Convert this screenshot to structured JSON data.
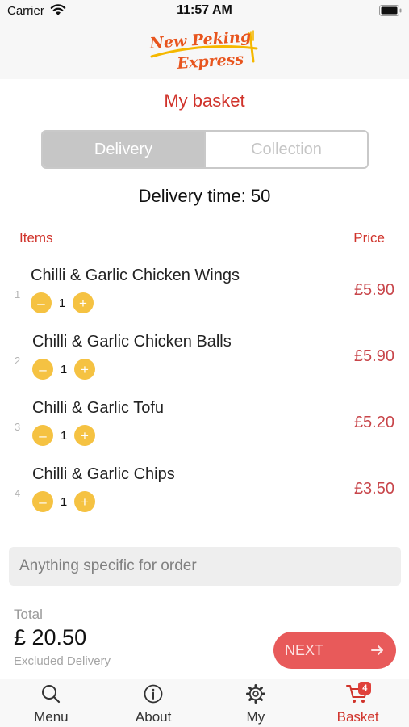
{
  "status_bar": {
    "carrier": "Carrier",
    "time": "11:57 AM"
  },
  "header": {
    "logo_line1": "New Peking",
    "logo_line2": "Express",
    "logo_color": "#e8551e",
    "logo_accent": "#f5b800"
  },
  "page": {
    "title": "My basket"
  },
  "order_type": {
    "options": [
      "Delivery",
      "Collection"
    ],
    "selected": "Delivery"
  },
  "delivery_time": "Delivery time: 50",
  "columns": {
    "items": "Items",
    "price": "Price"
  },
  "items": [
    {
      "index": "1",
      "name": "Chilli & Garlic Chicken Wings",
      "qty": "1",
      "price": "£5.90"
    },
    {
      "index": "2",
      "name": "Chilli & Garlic Chicken Balls",
      "qty": "1",
      "price": "£5.90"
    },
    {
      "index": "3",
      "name": "Chilli & Garlic Tofu",
      "qty": "1",
      "price": "£5.20"
    },
    {
      "index": "4",
      "name": "Chilli & Garlic Chips",
      "qty": "1",
      "price": "£3.50"
    }
  ],
  "qty_controls": {
    "minus": "–",
    "plus": "+"
  },
  "notes": {
    "placeholder": "Anything specific for order",
    "value": ""
  },
  "total": {
    "label": "Total",
    "value": "£ 20.50",
    "note": "Excluded Delivery"
  },
  "next_button": {
    "label": "NEXT",
    "icon": "arrow-right-icon"
  },
  "tabbar": {
    "tabs": [
      {
        "label": "Menu",
        "icon": "search-icon"
      },
      {
        "label": "About",
        "icon": "info-icon"
      },
      {
        "label": "My",
        "icon": "gear-icon"
      },
      {
        "label": "Basket",
        "icon": "cart-icon",
        "badge": "4"
      }
    ],
    "active": "Basket"
  },
  "colors": {
    "accent": "#d0332b",
    "price": "#c8454a",
    "qty_button": "#f5c242",
    "next_button": "#e85a5a"
  }
}
